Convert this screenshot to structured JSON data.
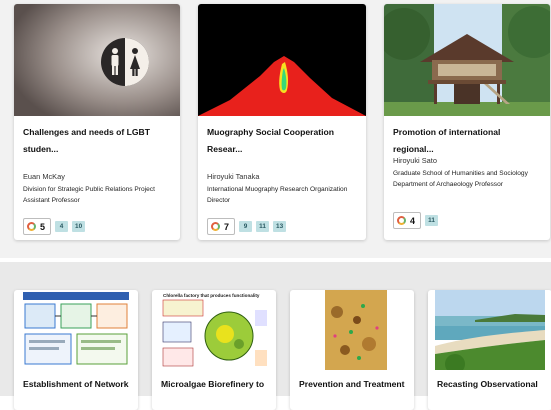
{
  "cards": [
    {
      "title": "Challenges and needs of LGBT studen...",
      "name": "Euan McKay",
      "affiliation": "Division for Strategic Public Relations Project Assistant Professor",
      "count": "5",
      "tags": [
        "4",
        "10"
      ]
    },
    {
      "title": "Muography Social Cooperation Resear...",
      "name": "Hiroyuki Tanaka",
      "affiliation": "International Muography Research Organization Director",
      "count": "7",
      "tags": [
        "9",
        "11",
        "13"
      ]
    },
    {
      "title": "Promotion of international regional...",
      "name": "Hiroyuki Sato",
      "affiliation": "Graduate School of Humanities and Sociology Department of Archaeology Professor",
      "count": "4",
      "tags": [
        "11"
      ]
    }
  ],
  "bottom_cards": [
    {
      "title": "Establishment of Network"
    },
    {
      "title": "Microalgae Biorefinery to"
    },
    {
      "title": "Prevention and Treatment"
    },
    {
      "title": "Recasting Observational"
    }
  ],
  "figure_text": {
    "chlorella": "Chlorella factory that produces functionality"
  },
  "colors": {
    "tag_bg": "#bfe0e3",
    "muography_red": "#e8211c"
  }
}
